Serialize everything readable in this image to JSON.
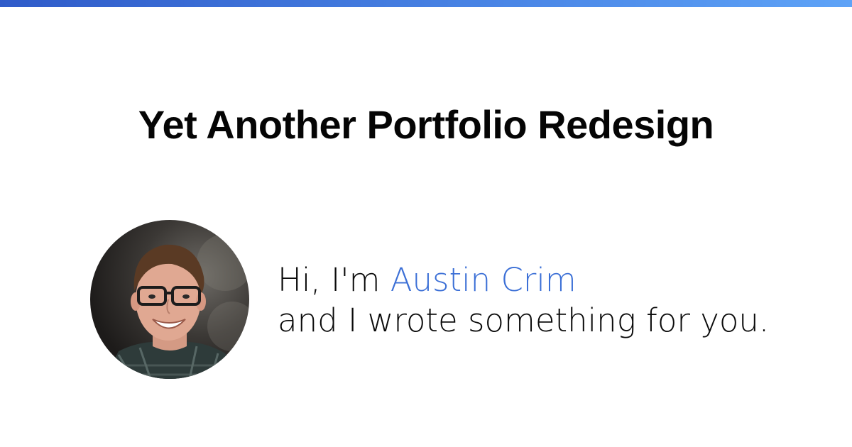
{
  "banner": {
    "accent_start": "#2f5bc9",
    "accent_end": "#5ea3f7"
  },
  "title": "Yet Another Portfolio Redesign",
  "avatar": {
    "icon": "portrait-photo"
  },
  "intro": {
    "greeting": "Hi, I'm ",
    "name": "Austin Crim",
    "name_color": "#3b6fd6",
    "line2": "and I wrote something for you."
  }
}
